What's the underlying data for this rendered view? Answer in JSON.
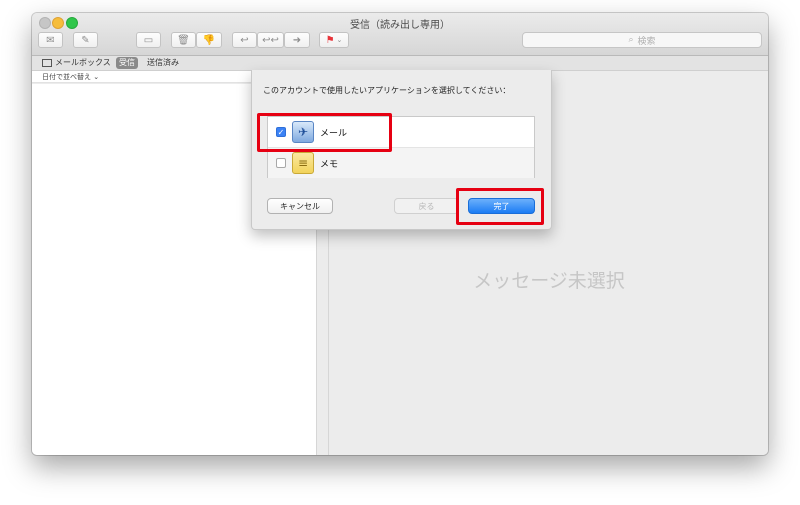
{
  "window": {
    "title": "受信（読み出し専用）"
  },
  "toolbar": {
    "search_placeholder": "検索",
    "icons": [
      "compose-mail-icon",
      "new-note-icon",
      "archive-icon",
      "trash-icon",
      "junk-icon",
      "reply-icon",
      "reply-all-icon",
      "forward-icon",
      "flag-icon"
    ]
  },
  "favorites": {
    "mailboxes_label": "メールボックス",
    "inbox_label": "受信",
    "sent_label": "送信済み"
  },
  "list": {
    "sort_label": "日付で並べ替え"
  },
  "detail": {
    "no_selection": "メッセージ未選択"
  },
  "sheet": {
    "prompt": "このアカウントで使用したいアプリケーションを選択してください：",
    "apps": [
      {
        "name": "メール",
        "checked": true,
        "icon": "mail-app-icon"
      },
      {
        "name": "メモ",
        "checked": false,
        "icon": "notes-app-icon"
      }
    ],
    "cancel_label": "キャンセル",
    "back_label": "戻る",
    "done_label": "完了"
  },
  "colors": {
    "accent": "#1c7cf4",
    "highlight": "#e60012"
  }
}
